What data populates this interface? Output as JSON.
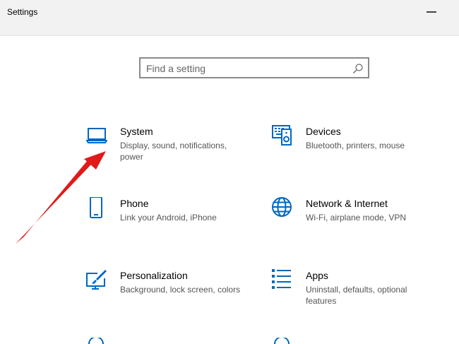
{
  "window": {
    "title": "Settings"
  },
  "search": {
    "placeholder": "Find a setting"
  },
  "tiles": [
    {
      "name": "System",
      "desc": "Display, sound, notifications, power",
      "icon": "laptop-icon"
    },
    {
      "name": "Devices",
      "desc": "Bluetooth, printers, mouse",
      "icon": "devices-icon"
    },
    {
      "name": "Phone",
      "desc": "Link your Android, iPhone",
      "icon": "phone-icon"
    },
    {
      "name": "Network & Internet",
      "desc": "Wi-Fi, airplane mode, VPN",
      "icon": "globe-icon"
    },
    {
      "name": "Personalization",
      "desc": "Background, lock screen, colors",
      "icon": "paint-screen-icon"
    },
    {
      "name": "Apps",
      "desc": "Uninstall, defaults, optional features",
      "icon": "apps-list-icon"
    }
  ],
  "colors": {
    "accent": "#0067c0",
    "arrow": "#e01a1a",
    "titlebar": "#f2f2f2"
  }
}
